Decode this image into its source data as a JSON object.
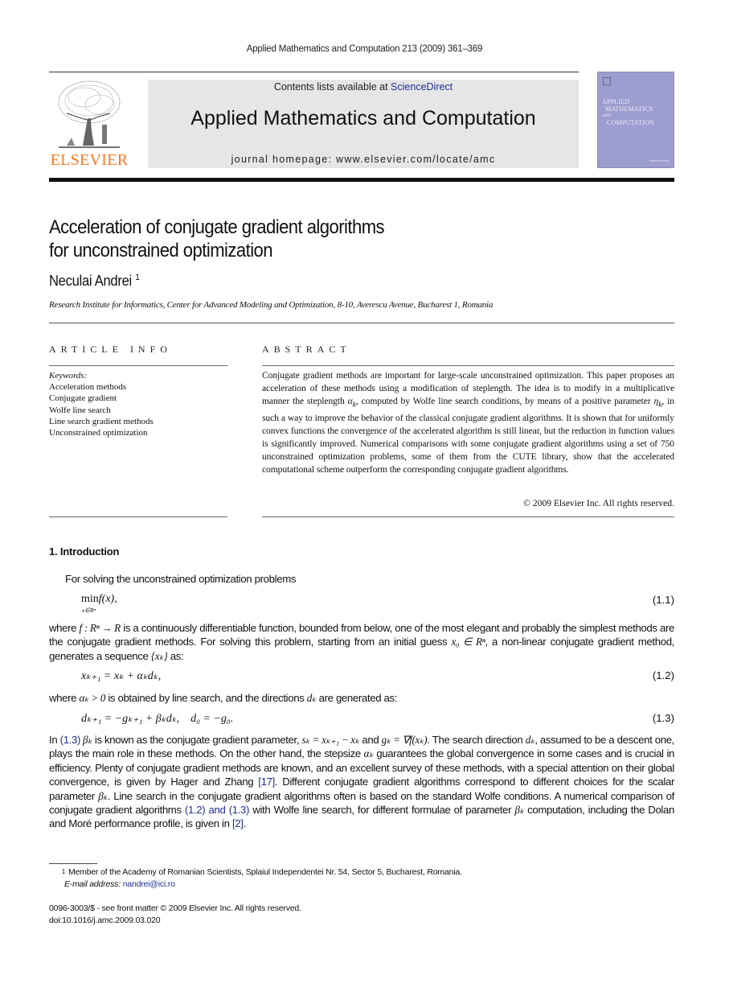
{
  "journal_citation": "Applied Mathematics and Computation 213 (2009) 361–369",
  "header": {
    "publisher_logo_text": "ELSEVIER",
    "contents_prefix": "Contents lists available at ",
    "contents_link": "ScienceDirect",
    "journal_title": "Applied Mathematics and Computation",
    "homepage": "journal homepage: www.elsevier.com/locate/amc",
    "cover": {
      "line1": "APPLIED",
      "line2": "MATHEMATICS",
      "line3": "AND",
      "line4": "COMPUTATION",
      "footer": "ScienceDirect",
      "color": "#9d9dd0"
    },
    "logo_color": "#f47b20"
  },
  "article": {
    "title_line1": "Acceleration of conjugate gradient algorithms",
    "title_line2": "for unconstrained optimization",
    "author": "Neculai Andrei",
    "author_mark": "1",
    "affiliation": "Research Institute for Informatics, Center for Advanced Modeling and Optimization, 8-10, Averescu Avenue, Bucharest 1, Romania"
  },
  "article_info": {
    "heading": "ARTICLE INFO",
    "keywords_label": "Keywords:",
    "keywords": [
      "Acceleration methods",
      "Conjugate gradient",
      "Wolfe line search",
      "Line search gradient methods",
      "Unconstrained optimization"
    ]
  },
  "abstract": {
    "heading": "ABSTRACT",
    "text_a": "Conjugate gradient methods are important for large-scale unconstrained optimization. This paper proposes an acceleration of these methods using a modification of steplength. The idea is to modify in a multiplicative manner the steplength ",
    "sym_alpha": "α",
    "sym_k": "k",
    "text_b": ", computed by Wolfe line search conditions, by means of a positive parameter ",
    "sym_eta": "η",
    "text_c": ", in such a way to improve the behavior of the classical conjugate gradient algorithms. It is shown that for uniformly convex functions the convergence of the accelerated algorithm is still linear, but the reduction in function values is significantly improved. Numerical comparisons with some conjugate gradient algorithms using a set of 750 unconstrained optimization problems, some of them from the CUTE library, show that the accelerated computational scheme outperform the corresponding conjugate gradient algorithms.",
    "copyright": "© 2009 Elsevier Inc. All rights reserved."
  },
  "introduction": {
    "heading": "1.  Introduction",
    "p1": "For solving the unconstrained optimization problems",
    "eq1": {
      "min": "min",
      "sub": "x∈Rⁿ",
      "expr": "f(x),",
      "number": "(1.1)"
    },
    "p2_a": "where ",
    "p2_f": "f : Rⁿ → R",
    "p2_b": " is a continuously differentiable function, bounded from below, one of the most elegant and probably the simplest methods are the conjugate gradient methods. For solving this problem, starting from an initial guess ",
    "p2_x0": "x₀ ∈ Rⁿ",
    "p2_c": ", a non-linear conjugate gradient method, generates a sequence ",
    "p2_seq": "{xₖ}",
    "p2_d": " as:",
    "eq2": {
      "expr": "xₖ₊₁ = xₖ + αₖdₖ,",
      "number": "(1.2)"
    },
    "p3_a": "where ",
    "p3_alpha": "αₖ > 0",
    "p3_b": " is obtained by line search, and the directions ",
    "p3_d": "dₖ",
    "p3_c": " are generated as:",
    "eq3": {
      "expr": "dₖ₊₁ = −gₖ₊₁ + βₖdₖ,    d₀ = −g₀.",
      "number": "(1.3)"
    },
    "p4_a": "In ",
    "p4_ref13": "(1.3)",
    "p4_beta": " βₖ",
    "p4_b": " is known as the conjugate gradient parameter, ",
    "p4_sk": "sₖ = xₖ₊₁ − xₖ",
    "p4_c": " and ",
    "p4_gk": "gₖ = ∇f(xₖ)",
    "p4_d": ". The search direction ",
    "p4_dk": "dₖ",
    "p4_e": ", assumed to be a descent one, plays the main role in these methods. On the other hand, the stepsize ",
    "p4_ak": "αₖ",
    "p4_f": " guarantees the global convergence in some cases and is crucial in efficiency. Plenty of conjugate gradient methods are known, and an excellent survey of these methods, with a special attention on their global convergence, is given by Hager and Zhang ",
    "p4_ref17": "[17]",
    "p4_g": ". Different conjugate gradient algorithms correspond to different choices for the scalar parameter ",
    "p4_bk": "βₖ",
    "p4_h": ". Line search in the conjugate gradient algorithms often is based on the standard Wolfe conditions. A numerical comparison of conjugate gradient algorithms ",
    "p4_ref1213": "(1.2) and (1.3)",
    "p4_i": " with Wolfe line search, for different formulae of parameter ",
    "p4_bk2": "βₖ",
    "p4_j": " computation, including the Dolan and Moré performance profile, is given in ",
    "p4_ref2": "[2]",
    "p4_k": "."
  },
  "footnote": {
    "mark": "1",
    "text": "Member of the Academy of Romanian Scientists, Splaiul Independentei Nr. 54, Sector 5, Bucharest, Romania.",
    "email_label": "E-mail address:",
    "email": "nandrei@ici.ro"
  },
  "front_matter": {
    "line1": "0096-3003/$ - see front matter © 2009 Elsevier Inc. All rights reserved.",
    "line2": "doi:10.1016/j.amc.2009.03.020"
  },
  "link_color": "#1f2f8f"
}
